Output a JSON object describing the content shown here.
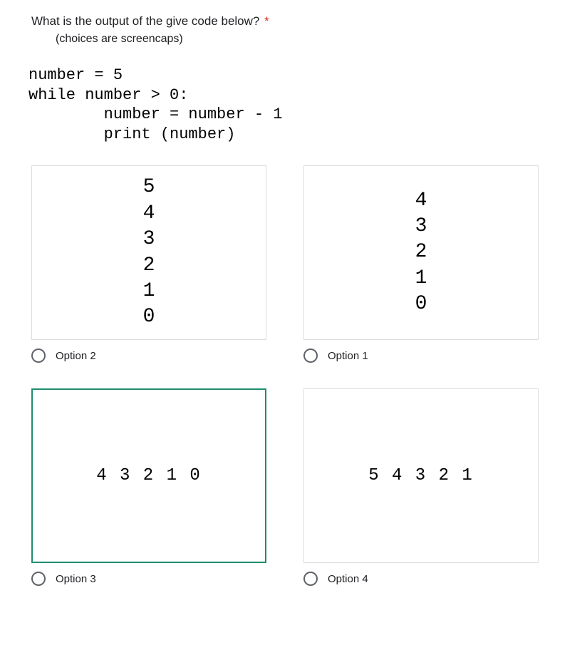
{
  "question": {
    "title": "What is the output of the give code below?",
    "required_mark": "*",
    "caption": "(choices are screencaps)",
    "code": "number = 5\nwhile number > 0:\n        number = number - 1\n        print (number)"
  },
  "options": [
    {
      "label": "Option 2",
      "layout": "vertical",
      "content": "5\n4\n3\n2\n1\n0",
      "selected": false
    },
    {
      "label": "Option 1",
      "layout": "vertical",
      "content": "4\n3\n2\n1\n0",
      "selected": false
    },
    {
      "label": "Option 3",
      "layout": "horizontal",
      "content": "4 3 2 1 0",
      "selected": true
    },
    {
      "label": "Option 4",
      "layout": "horizontal",
      "content": "5 4 3 2 1",
      "selected": false
    }
  ]
}
